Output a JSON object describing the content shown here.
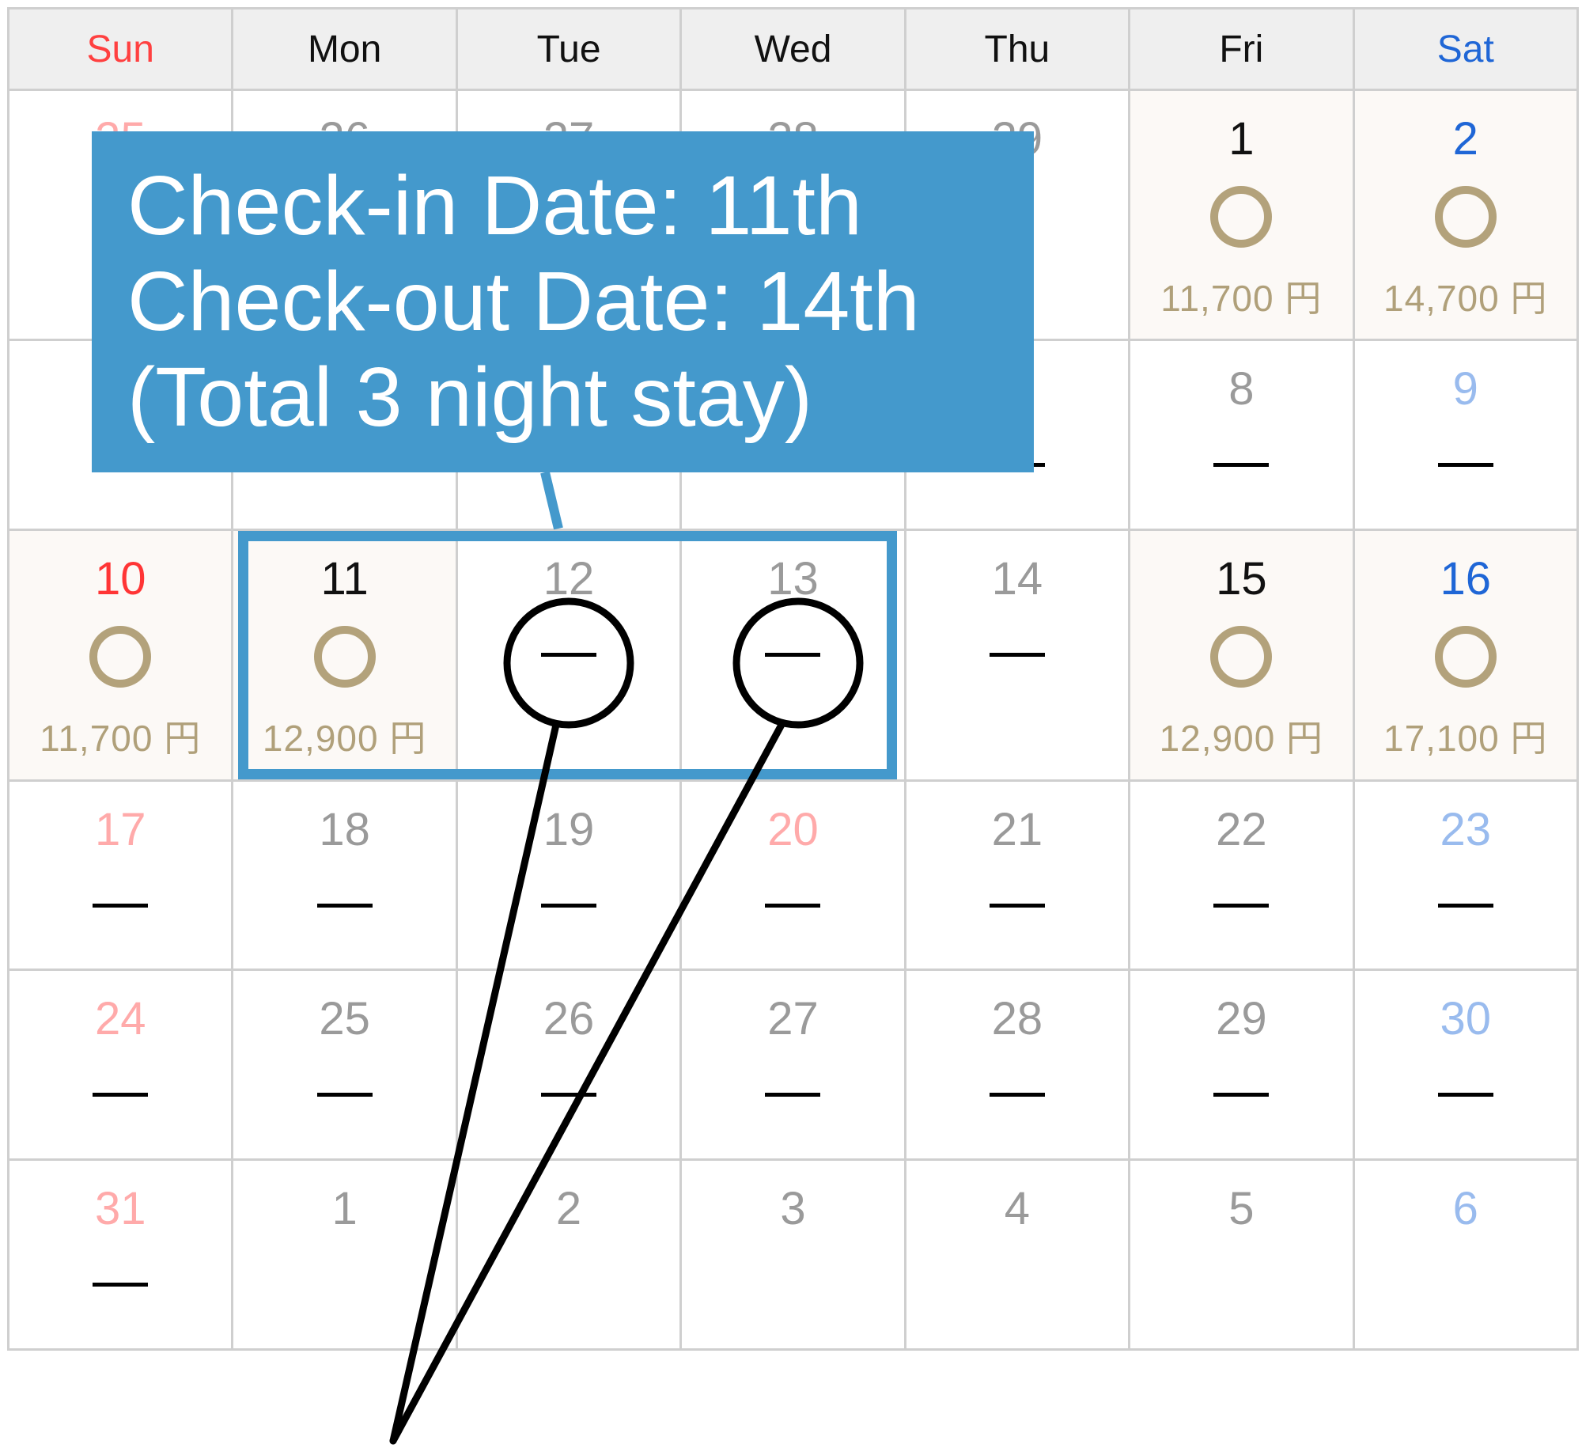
{
  "weekdays": [
    {
      "label": "Sun",
      "cls": "sun"
    },
    {
      "label": "Mon",
      "cls": ""
    },
    {
      "label": "Tue",
      "cls": ""
    },
    {
      "label": "Wed",
      "cls": ""
    },
    {
      "label": "Thu",
      "cls": ""
    },
    {
      "label": "Fri",
      "cls": ""
    },
    {
      "label": "Sat",
      "cls": "sat"
    }
  ],
  "colors": {
    "accent": "#4499cc",
    "available_bg": "#fcf9f6",
    "circle": "#b3a27b",
    "sunday": "#ff3535",
    "saturday": "#1f66d6"
  },
  "rows": [
    {
      "cells": [
        {
          "date": "25",
          "color": "sun-off"
        },
        {
          "date": "26",
          "color": "wk-off"
        },
        {
          "date": "27",
          "color": "wk-off"
        },
        {
          "date": "28",
          "color": "wk-off"
        },
        {
          "date": "29",
          "color": "wk-off"
        },
        {
          "date": "1",
          "color": "wk",
          "avail": true,
          "mark": "circle",
          "price": "11,700 円"
        },
        {
          "date": "2",
          "color": "sat",
          "avail": true,
          "mark": "circle",
          "price": "14,700 円"
        }
      ]
    },
    {
      "cells": [
        {
          "date": "",
          "color": "sun-off",
          "mark": "dash"
        },
        {
          "date": "",
          "color": "wk-off",
          "mark": "dash"
        },
        {
          "date": "",
          "color": "wk-off",
          "mark": "dash"
        },
        {
          "date": "",
          "color": "wk-off",
          "mark": "dash"
        },
        {
          "date": "",
          "color": "wk-off",
          "mark": "dash"
        },
        {
          "date": "8",
          "color": "wk-off",
          "mark": "dash"
        },
        {
          "date": "9",
          "color": "sat-off",
          "mark": "dash"
        }
      ]
    },
    {
      "cells": [
        {
          "date": "10",
          "color": "sun",
          "avail": true,
          "mark": "circle",
          "price": "11,700 円"
        },
        {
          "date": "11",
          "color": "wk",
          "avail": true,
          "mark": "circle",
          "price": "12,900 円"
        },
        {
          "date": "12",
          "color": "wk-off",
          "mark": "dash"
        },
        {
          "date": "13",
          "color": "wk-off",
          "mark": "dash"
        },
        {
          "date": "14",
          "color": "wk-off",
          "mark": "dash"
        },
        {
          "date": "15",
          "color": "wk",
          "avail": true,
          "mark": "circle",
          "price": "12,900 円"
        },
        {
          "date": "16",
          "color": "sat",
          "avail": true,
          "mark": "circle",
          "price": "17,100 円"
        }
      ]
    },
    {
      "cells": [
        {
          "date": "17",
          "color": "sun-off",
          "mark": "dash"
        },
        {
          "date": "18",
          "color": "wk-off",
          "mark": "dash"
        },
        {
          "date": "19",
          "color": "wk-off",
          "mark": "dash"
        },
        {
          "date": "20",
          "color": "sun-off",
          "mark": "dash"
        },
        {
          "date": "21",
          "color": "wk-off",
          "mark": "dash"
        },
        {
          "date": "22",
          "color": "wk-off",
          "mark": "dash"
        },
        {
          "date": "23",
          "color": "sat-off",
          "mark": "dash"
        }
      ]
    },
    {
      "cells": [
        {
          "date": "24",
          "color": "sun-off",
          "mark": "dash"
        },
        {
          "date": "25",
          "color": "wk-off",
          "mark": "dash"
        },
        {
          "date": "26",
          "color": "wk-off",
          "mark": "dash"
        },
        {
          "date": "27",
          "color": "wk-off",
          "mark": "dash"
        },
        {
          "date": "28",
          "color": "wk-off",
          "mark": "dash"
        },
        {
          "date": "29",
          "color": "wk-off",
          "mark": "dash"
        },
        {
          "date": "30",
          "color": "sat-off",
          "mark": "dash"
        }
      ]
    },
    {
      "cells": [
        {
          "date": "31",
          "color": "sun-off",
          "mark": "dash"
        },
        {
          "date": "1",
          "color": "wk-off"
        },
        {
          "date": "2",
          "color": "wk-off"
        },
        {
          "date": "3",
          "color": "wk-off"
        },
        {
          "date": "4",
          "color": "wk-off"
        },
        {
          "date": "5",
          "color": "wk-off"
        },
        {
          "date": "6",
          "color": "sat-off"
        }
      ]
    }
  ],
  "callout": {
    "line1": "Check-in Date: 11th",
    "line2": "Check-out Date: 14th",
    "line3": "(Total 3 night stay)"
  }
}
